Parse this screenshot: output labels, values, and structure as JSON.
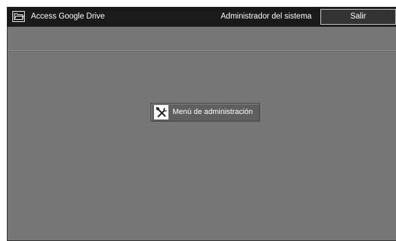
{
  "header": {
    "app_title": "Access Google Drive",
    "user_label": "Administrador del sistema",
    "exit_label": "Salir",
    "app_icon": "folder-icon"
  },
  "main": {
    "admin_menu_label": "Menú de administración",
    "admin_menu_icon": "tools-icon"
  },
  "colors": {
    "titlebar": "#1a1a1a",
    "panel": "#767676",
    "button": "#5f5f5f"
  }
}
